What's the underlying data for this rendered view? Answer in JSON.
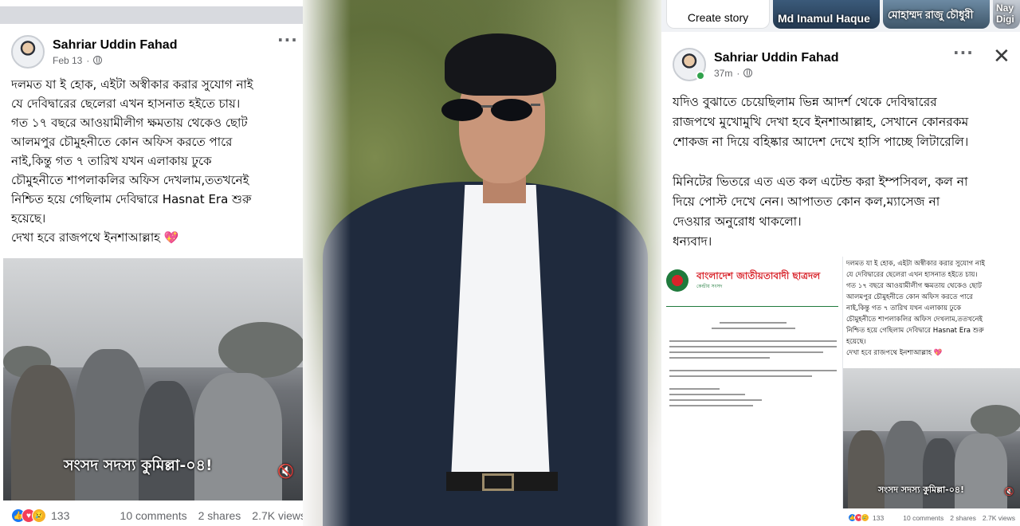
{
  "left_post": {
    "author": "Sahriar Uddin Fahad",
    "date": "Feb 13",
    "more": "···",
    "body": "দলমত যা ই হোক, এইটা অস্বীকার করার সুযোগ নাই\nযে দেবিদ্বারের ছেলেরা এখন হাসনাত হইতে চায়।\nগত ১৭ বছরে আওয়ামীলীগ ক্ষমতায় থেকেও ছোট\nআলমপুর চৌমুহনীতে কোন অফিস করতে পারে\nনাই,কিন্তু গত ৭ তারিখ যখন এলাকায় ঢুকে\nচৌমুহনীতে শাপলাকলির অফিস দেখলাম,ততখনেই\nনিশ্চিত হয়ে গেছিলাম দেবিদ্বারে Hasnat Era শুরু\nহয়েছে।\nদেখা হবে রাজপথে ইনশাআল্লাহ",
    "heart": "💖",
    "video_caption": "সংসদ সদস্য কুমিল্লা-০৪!",
    "mute_icon": "🔇",
    "reaction_count": "133",
    "comments": "10 comments",
    "shares": "2 shares",
    "views": "2.7K views"
  },
  "right_panel": {
    "stories": {
      "create_label": "Create story",
      "story1_name": "Md Inamul Haque",
      "story2_name": "মোহাম্মদ রাজু চৌধুরী",
      "story3_name": "Nay Digi"
    },
    "post": {
      "author": "Sahriar Uddin Fahad",
      "time": "37m",
      "more": "···",
      "close": "✕",
      "body": "যদিও বুঝাতে চেয়েছিলাম ভিন্ন আদর্শ থেকে দেবিদ্বারের\nরাজপথে মুখোমুখি দেখা হবে ইনশাআল্লাহ, সেখানে কোনরকম\nশোকজ না দিয়ে বহিষ্কার আদেশ দেখে হাসি পাচ্ছে লিটারেলি।\n\nমিনিটের ভিতরে এত এত কল এটেন্ড করা ইম্পসিবল, কল না\nদিয়ে পোস্ট দেখে নেন। আপাতত কোন কল,ম্যাসেজ না\nদেওয়ার অনুরোধ থাকলো।\nধন্যবাদ।"
    },
    "document": {
      "title": "বাংলাদেশ জাতীয়তাবাদী ছাত্রদল",
      "subtitle": "কেন্দ্রীয় সংসদ"
    },
    "shared_post": {
      "body": "দলমত যা ই হোক, এইটা অস্বীকার করার সুযোগ নাই\nযে দেবিদ্বারের ছেলেরা এখন হাসনাত হইতে চায়।\nগত ১৭ বছরে আওয়ামীলীগ ক্ষমতায় থেকেও ছোট\nআলমপুর চৌমুহনীতে কোন অফিস করতে পারে\nনাই,কিন্তু গত ৭ তারিখ যখন এলাকায় ঢুকে\nচৌমুহনীতে শাপলাকলির অফিস দেখলাম,ততখনেই\nনিশ্চিত হয়ে গেছিলাম দেবিদ্বারে Hasnat Era শুরু\nহয়েছে।\nদেখা হবে রাজপথে ইনশাআল্লাহ",
      "heart": "💖",
      "video_caption": "সংসদ সদস্য কুমিল্লা-০৪!",
      "mute_icon": "🔇",
      "reaction_count": "133",
      "comments": "10 comments",
      "shares": "2 shares",
      "views": "2.7K views"
    }
  },
  "icons": {
    "like": "👍",
    "love": "♥",
    "care": "😢"
  },
  "colors": {
    "facebook_blue": "#1877f2",
    "online_green": "#31a24c",
    "bnp_red": "#d8232a",
    "bnp_green": "#1f7a3c"
  }
}
